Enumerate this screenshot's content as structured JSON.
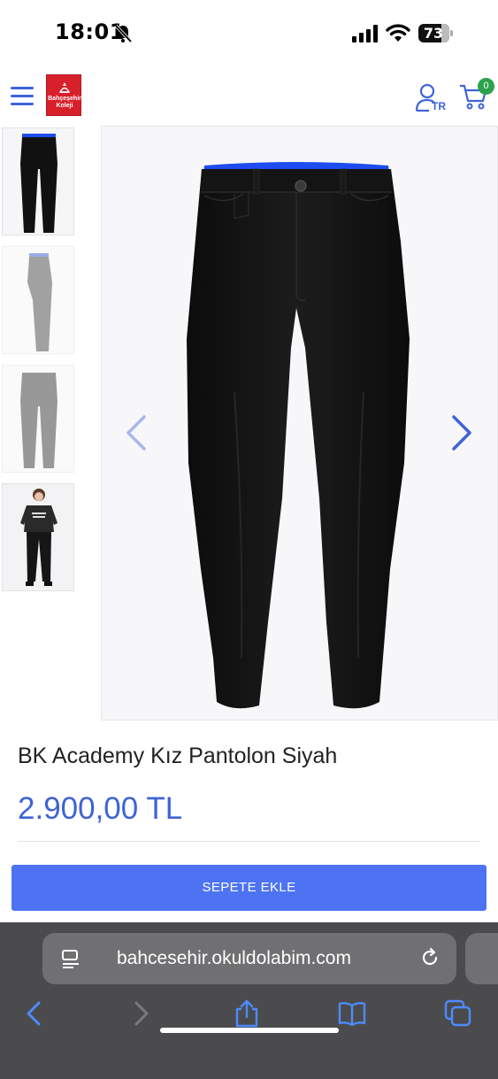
{
  "status_bar": {
    "time": "18:01",
    "battery": "73"
  },
  "header": {
    "logo_text_line1": "Bahçeşehir",
    "logo_text_line2": "Koleji",
    "user_lang": "TR",
    "cart_count": "0"
  },
  "product": {
    "title": "BK Academy Kız Pantolon Siyah",
    "price": "2.900,00 TL",
    "add_to_cart_label": "SEPETE EKLE"
  },
  "browser": {
    "url": "bahcesehir.okuldolabim.com"
  },
  "colors": {
    "accent": "#3e63d8",
    "button": "#4d73f2",
    "waistband": "#1d4df0",
    "logo": "#d8202a",
    "badge": "#2aa34a"
  },
  "icons": [
    "menu-icon",
    "user-icon",
    "cart-icon",
    "chevron-left-icon",
    "chevron-right-icon",
    "reader-icon",
    "reload-icon",
    "back-icon",
    "forward-icon",
    "share-icon",
    "bookmarks-icon",
    "tabs-icon"
  ]
}
